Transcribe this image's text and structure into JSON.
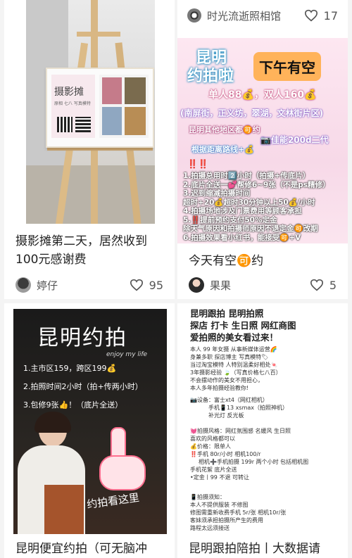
{
  "feed": {
    "cards": [
      {
        "title": "摄影摊第二天，居然收到100元感谢费",
        "author": "婷仔",
        "likes": "95",
        "image_text": {
          "stall_sign": "摄影摊",
          "stall_sub": "原相 七八 写真模特"
        }
      },
      {
        "title": "今天有空🉑约",
        "author": "果果",
        "likes": "5",
        "poster": {
          "headline_a": "昆明",
          "headline_b": "约拍啦",
          "badge": "下午有空",
          "price": "单人88💰，双人160💰",
          "places": "(南屏街，正义坊，翠湖，文林街片区)",
          "other": "昆明其他地区都🉑约",
          "camera": "📷佳能200d二代",
          "distance": "根据距离路线+💰",
          "alert": "‼️‼️",
          "rules": [
            "1.拍摄总用时2️⃣小时（拍摄+传底片）",
            "2.底片全送一💕帮修6~9张（不是ps精修）",
            "3.迟到缩减拍摄时间",
            "超时+20💰超时30分钟以上50💰/小时",
            "4.拍摄场地涉及门票费用等顾客承担",
            "5.‼️提前预约支付50%定金",
            "除天气原因和拍摄师原因不退定金🉑改期",
            "6.拍摄效果看小红书，能接受🉑+V"
          ]
        }
      },
      {
        "title": "昆明便宜约拍（可无脑冲",
        "header_author": "时光流逝照相馆",
        "header_likes": "17",
        "poster": {
          "headline": "昆明约拍",
          "tag": "enjoy my life",
          "lines": [
            "1.主市区159，跨区199💰",
            "2.拍照时间2小时（拍+传两小时）",
            "3.包修9张👍！（底片全送）"
          ],
          "cta": "约拍看这里"
        }
      },
      {
        "title": "昆明跟拍陪拍丨大数据请",
        "text": {
          "headline": [
            "昆明跟拍 昆明拍照",
            "探店 打卡 生日照 网红商图",
            "爱拍照的美女看过来！"
          ],
          "intro": [
            "本人 99 年女摄 从事新媒体运营🌈",
            "身兼多职 探店博主 写真模特🏷",
            "当过淘宝模特 人特别温柔好相处🍬",
            "3年摄影经验 🍃（写真价格七八百）",
            "不会摆动作的美女不用担心，",
            "本人多年拍摄经验教你!"
          ],
          "gear": [
            "📷设备：富士xt4（网红相机）",
            "手机📱13 xsmax（拍照神机）",
            "补光灯 反光板"
          ],
          "service": [
            "💓拍摄风格：网红氛围感 名媛风 生日照",
            "喜欢的风格都可以",
            "💰价格：限单人",
            "‼️手机 80r/小时 相机100/r",
            "相机➕手机拍摄 199r 两个小时 包括相机图",
            "手机花絮 底片全送",
            "•定金丨99 不退 可转让"
          ],
          "notice": [
            "📱拍摄须知：",
            "本人不提供服装 不修图",
            "修图需重新收费手机 5r/张 相机10r/张",
            "客妹须承担拍摄所产生的费用",
            "路程太远须接送"
          ]
        }
      }
    ]
  },
  "colors": {
    "heart": "#555555",
    "poster_pink": "#f6d3e6",
    "poster_blue": "#8fd3ec"
  },
  "icons": [
    "heart-icon",
    "camera-icon",
    "avatar"
  ]
}
